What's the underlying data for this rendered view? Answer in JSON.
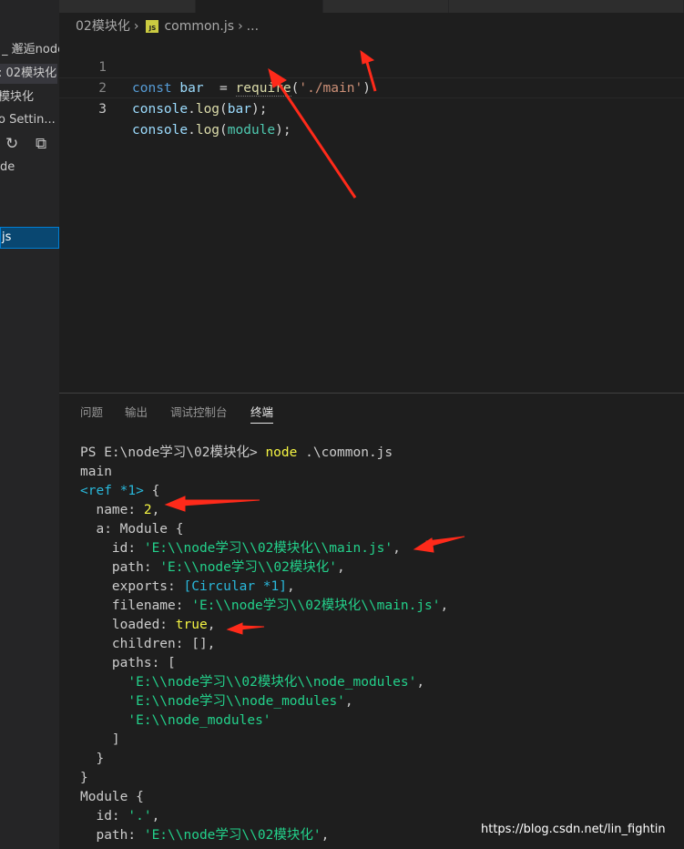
{
  "sidebar": {
    "rows": [
      "_ 邂逅node",
      "02模块化",
      "模块化",
      "o Settin...",
      "de"
    ],
    "row_prefix": ":",
    "selected_file": "js",
    "refresh_icon": "↻",
    "collapse_icon": "⧉"
  },
  "breadcrumb": {
    "folder": "02模块化",
    "file_badge": "JS",
    "file": "common.js",
    "trail": "..."
  },
  "code_lines": [
    {
      "num": "1"
    },
    {
      "num": "2"
    },
    {
      "num": "3"
    }
  ],
  "code": {
    "line1": {
      "kw": "const",
      "var": "bar",
      "eq": "  = ",
      "fn": "require",
      "open": "(",
      "str": "'./main'",
      "close": ")"
    },
    "line2": {
      "obj": "console",
      "dot": ".",
      "fn": "log",
      "open": "(",
      "arg": "bar",
      "close": ");"
    },
    "line3": {
      "obj": "console",
      "dot": ".",
      "fn": "log",
      "open": "(",
      "arg": "module",
      "close": ");"
    }
  },
  "panel_tabs": [
    "问题",
    "输出",
    "调试控制台",
    "终端"
  ],
  "terminal": {
    "prompt": "PS E:\\node学习\\02模块化> ",
    "command": "node",
    "command_args": " .\\common.js",
    "lines": [
      "main",
      "<ref *1> {",
      "  name: 2,",
      "  a: Module {",
      "    id: 'E:\\\\node学习\\\\02模块化\\\\main.js',",
      "    path: 'E:\\\\node学习\\\\02模块化',",
      "    exports: [Circular *1],",
      "    filename: 'E:\\\\node学习\\\\02模块化\\\\main.js',",
      "    loaded: true,",
      "    children: [],",
      "    paths: [",
      "      'E:\\\\node学习\\\\02模块化\\\\node_modules',",
      "      'E:\\\\node学习\\\\node_modules',",
      "      'E:\\\\node_modules'",
      "    ]",
      "  }",
      "}",
      "Module {",
      "  id: '.',",
      "  path: 'E:\\\\node学习\\\\02模块化',"
    ]
  },
  "watermark": "https://blog.csdn.net/lin_fightin",
  "colors": {
    "editor_bg": "#1e1e1e",
    "sidebar_bg": "#252526",
    "keyword": "#569cd6",
    "variable": "#9cdcfe",
    "function": "#dcdcaa",
    "string": "#ce9178",
    "terminal_string": "#23d18b",
    "terminal_number": "#f5f543",
    "terminal_cyan": "#29b8db",
    "annotation_arrow": "#ff2a1a",
    "selection": "#094771"
  }
}
